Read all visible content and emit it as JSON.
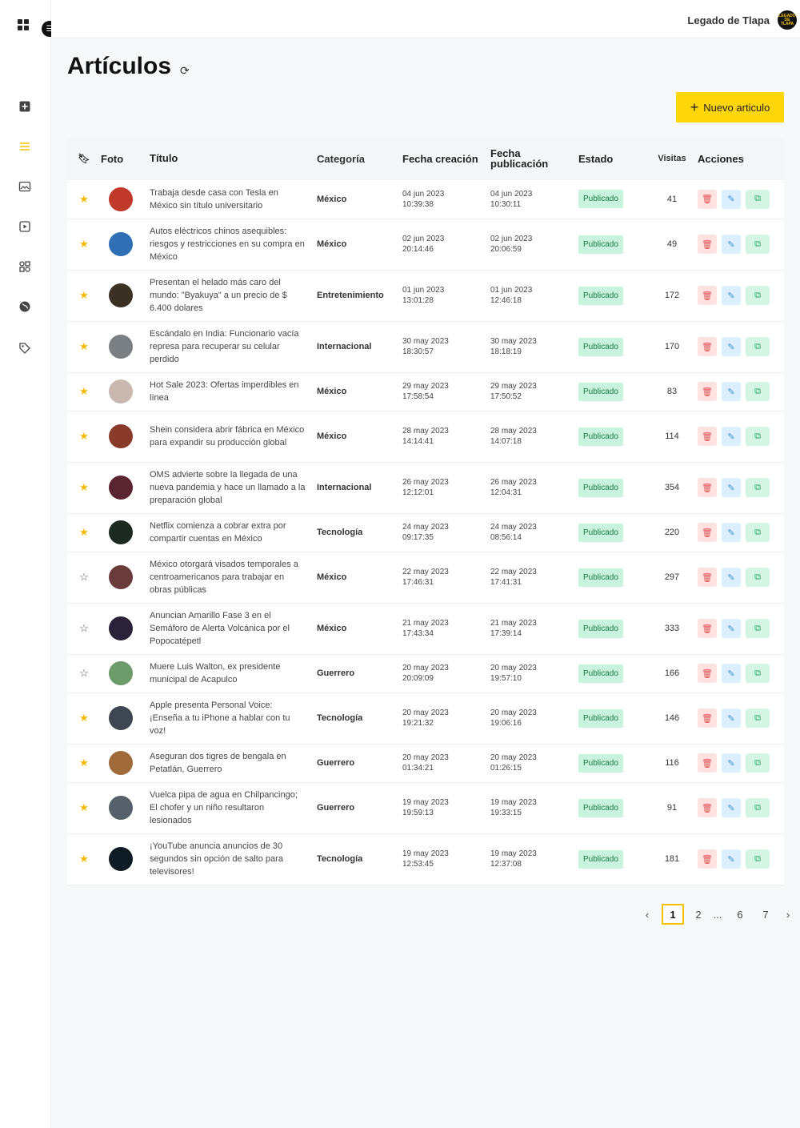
{
  "header": {
    "brand": "Legado de Tlapa",
    "logo_text": "LEGADO DE TLAPA"
  },
  "page": {
    "title": "Artículos",
    "new_button": "Nuevo articulo"
  },
  "table": {
    "columns": [
      "Foto",
      "Título",
      "Categoría",
      "Fecha creación",
      "Fecha publicación",
      "Estado",
      "Visitas",
      "Acciones"
    ],
    "rows": [
      {
        "starred": true,
        "title": "Trabaja desde casa con Tesla en México sin título universitario",
        "category": "México",
        "created_date": "04 jun 2023",
        "created_time": "10:39:38",
        "published_date": "04 jun 2023",
        "published_time": "10:30:11",
        "status": "Publicado",
        "visits": "41",
        "photo_color": "#c0392b"
      },
      {
        "starred": true,
        "title": "Autos eléctricos chinos asequibles: riesgos y restricciones en su compra en México",
        "category": "México",
        "created_date": "02 jun 2023",
        "created_time": "20:14:46",
        "published_date": "02 jun 2023",
        "published_time": "20:06:59",
        "status": "Publicado",
        "visits": "49",
        "photo_color": "#2e6fb5"
      },
      {
        "starred": true,
        "title": "Presentan el helado más caro del mundo: \"Byakuya\" a un precio de $ 6.400 dolares",
        "category": "Entretenimiento",
        "created_date": "01 jun 2023",
        "created_time": "13:01:28",
        "published_date": "01 jun 2023",
        "published_time": "12:46:18",
        "status": "Publicado",
        "visits": "172",
        "photo_color": "#3b3024"
      },
      {
        "starred": true,
        "title": "Escándalo en India: Funcionario vacía represa para recuperar su celular perdido",
        "category": "Internacional",
        "created_date": "30 may 2023",
        "created_time": "18:30:57",
        "published_date": "30 may 2023",
        "published_time": "18:18:19",
        "status": "Publicado",
        "visits": "170",
        "photo_color": "#7a7f84"
      },
      {
        "starred": true,
        "title": "Hot Sale 2023: Ofertas imperdibles en línea",
        "category": "México",
        "created_date": "29 may 2023",
        "created_time": "17:58:54",
        "published_date": "29 may 2023",
        "published_time": "17:50:52",
        "status": "Publicado",
        "visits": "83",
        "photo_color": "#c9b7b0"
      },
      {
        "starred": true,
        "title": "Shein considera abrir fábrica en México para expandir su producción global",
        "category": "México",
        "created_date": "28 may 2023",
        "created_time": "14:14:41",
        "published_date": "28 may 2023",
        "published_time": "14:07:18",
        "status": "Publicado",
        "visits": "114",
        "photo_color": "#8a3a2a"
      },
      {
        "starred": true,
        "title": "OMS advierte sobre la llegada de una nueva pandemia y hace un llamado a la preparación global",
        "category": "Internacional",
        "created_date": "26 may 2023",
        "created_time": "12:12:01",
        "published_date": "26 may 2023",
        "published_time": "12:04:31",
        "status": "Publicado",
        "visits": "354",
        "photo_color": "#5a2530"
      },
      {
        "starred": true,
        "title": "Netflix comienza a cobrar extra por compartir cuentas en México",
        "category": "Tecnología",
        "created_date": "24 may 2023",
        "created_time": "09:17:35",
        "published_date": "24 may 2023",
        "published_time": "08:56:14",
        "status": "Publicado",
        "visits": "220",
        "photo_color": "#1c2a22"
      },
      {
        "starred": false,
        "title": "México otorgará visados temporales a centroamericanos para trabajar en obras públicas",
        "category": "México",
        "created_date": "22 may 2023",
        "created_time": "17:46:31",
        "published_date": "22 may 2023",
        "published_time": "17:41:31",
        "status": "Publicado",
        "visits": "297",
        "photo_color": "#6b3b3b"
      },
      {
        "starred": false,
        "title": "Anuncian Amarillo Fase 3 en el Semáforo de Alerta Volcánica por el Popocatépetl",
        "category": "México",
        "created_date": "21 may 2023",
        "created_time": "17:43:34",
        "published_date": "21 may 2023",
        "published_time": "17:39:14",
        "status": "Publicado",
        "visits": "333",
        "photo_color": "#2a2238"
      },
      {
        "starred": false,
        "title": "Muere Luis Walton, ex presidente municipal de Acapulco",
        "category": "Guerrero",
        "created_date": "20 may 2023",
        "created_time": "20:09:09",
        "published_date": "20 may 2023",
        "published_time": "19:57:10",
        "status": "Publicado",
        "visits": "166",
        "photo_color": "#6c9a6a"
      },
      {
        "starred": true,
        "title": "Apple presenta Personal Voice: ¡Enseña a tu iPhone a hablar con tu voz!",
        "category": "Tecnología",
        "created_date": "20 may 2023",
        "created_time": "19:21:32",
        "published_date": "20 may 2023",
        "published_time": "19:06:16",
        "status": "Publicado",
        "visits": "146",
        "photo_color": "#3d4652"
      },
      {
        "starred": true,
        "title": "Aseguran dos tigres de bengala en Petatlán, Guerrero",
        "category": "Guerrero",
        "created_date": "20 may 2023",
        "created_time": "01:34:21",
        "published_date": "20 may 2023",
        "published_time": "01:26:15",
        "status": "Publicado",
        "visits": "116",
        "photo_color": "#a06a3a"
      },
      {
        "starred": true,
        "title": "Vuelca pipa de agua en Chilpancingo; El chofer y un niño resultaron lesionados",
        "category": "Guerrero",
        "created_date": "19 may 2023",
        "created_time": "19:59:13",
        "published_date": "19 may 2023",
        "published_time": "19:33:15",
        "status": "Publicado",
        "visits": "91",
        "photo_color": "#55606a"
      },
      {
        "starred": true,
        "title": "¡YouTube anuncia anuncios de 30 segundos sin opción de salto para televisores!",
        "category": "Tecnología",
        "created_date": "19 may 2023",
        "created_time": "12:53:45",
        "published_date": "19 may 2023",
        "published_time": "12:37:08",
        "status": "Publicado",
        "visits": "181",
        "photo_color": "#0e1a24"
      }
    ]
  },
  "pagination": {
    "prev": "‹",
    "pages": [
      "1",
      "2",
      "...",
      "6",
      "7"
    ],
    "current": "1",
    "next": "›"
  },
  "colors": {
    "accent": "#ffd60a",
    "published_bg": "#c8f3dc"
  }
}
